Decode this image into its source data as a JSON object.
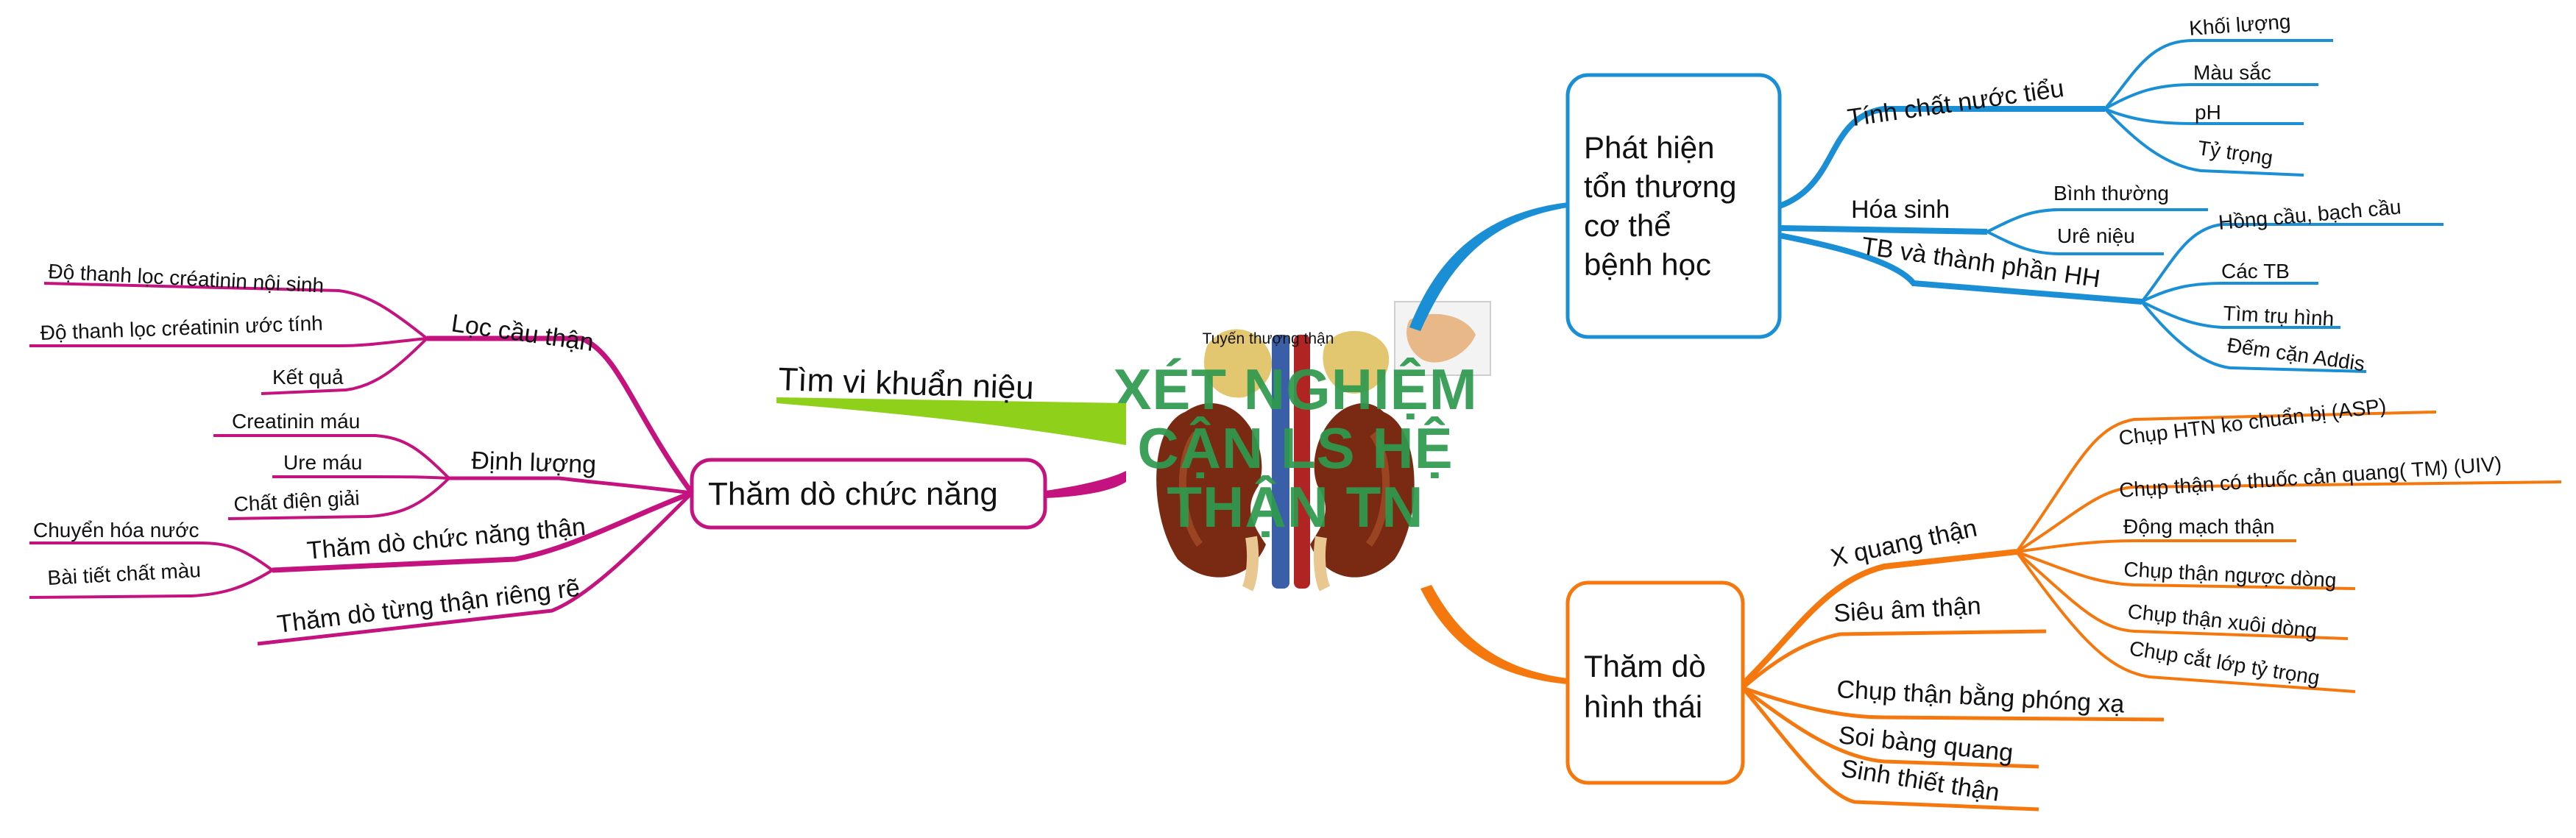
{
  "center": {
    "title_lines": [
      "XÉT NGHIỆM",
      "CẬN LS HỆ",
      "THẬN TN"
    ],
    "image_label": "Tuyến thượng thận"
  },
  "colors": {
    "blue": "#1a8fd6",
    "orange": "#f5780f",
    "magenta": "#c4137f",
    "green": "#8fd11a",
    "title_green": "#2e9a4e"
  },
  "branches": {
    "phat_hien": {
      "title_lines": [
        "Phát hiện",
        "tổn thương",
        "cơ thể",
        "bệnh học"
      ],
      "tinh_chat": {
        "label": "Tính chất nước tiểu",
        "items": [
          "Khối lượng",
          "Màu sắc",
          "pH",
          "Tỷ trọng"
        ]
      },
      "hoa_sinh": {
        "label": "Hóa sinh",
        "items": [
          "Bình thường",
          "Urê niệu"
        ]
      },
      "tb": {
        "label": "TB và thành phần HH",
        "items": [
          "Hồng cầu, bạch cầu",
          "Các TB",
          "Tìm trụ hình",
          "Đếm cặn Addis"
        ]
      }
    },
    "hinh_thai": {
      "title_lines": [
        "Thăm dò",
        "hình thái"
      ],
      "x_quang": {
        "label": "X quang thận",
        "items": [
          "Chụp HTN ko chuẩn bị (ASP)",
          "Chụp thận có thuốc cản quang( TM) (UIV)",
          "Động mạch thận",
          "Chụp thận ngược dòng",
          "Chụp thận xuôi dòng",
          "Chụp cắt lớp tỷ trọng"
        ]
      },
      "others": [
        "Siêu âm thận",
        "Chụp thận bằng phóng xạ",
        "Soi bàng quang",
        "Sinh thiết thận"
      ]
    },
    "tim_vi_khuan": {
      "label": "Tìm vi khuẩn niệu"
    },
    "chuc_nang": {
      "title": "Thăm dò chức năng",
      "loc_cau_than": {
        "label": "Lọc cầu thận",
        "items": [
          "Độ thanh lọc créatinin nội sinh",
          "Độ thanh lọc créatinin ước tính",
          "Kết quả"
        ]
      },
      "dinh_luong": {
        "label": "Định lượng",
        "items": [
          "Creatinin máu",
          "Ure máu",
          "Chất điện giải"
        ]
      },
      "cn_than": {
        "label": "Thăm dò chức năng thận",
        "items": [
          "Chuyển hóa nước",
          "Bài tiết chất màu"
        ]
      },
      "tung_than": {
        "label": "Thăm dò từng thận riêng rẽ"
      }
    }
  }
}
